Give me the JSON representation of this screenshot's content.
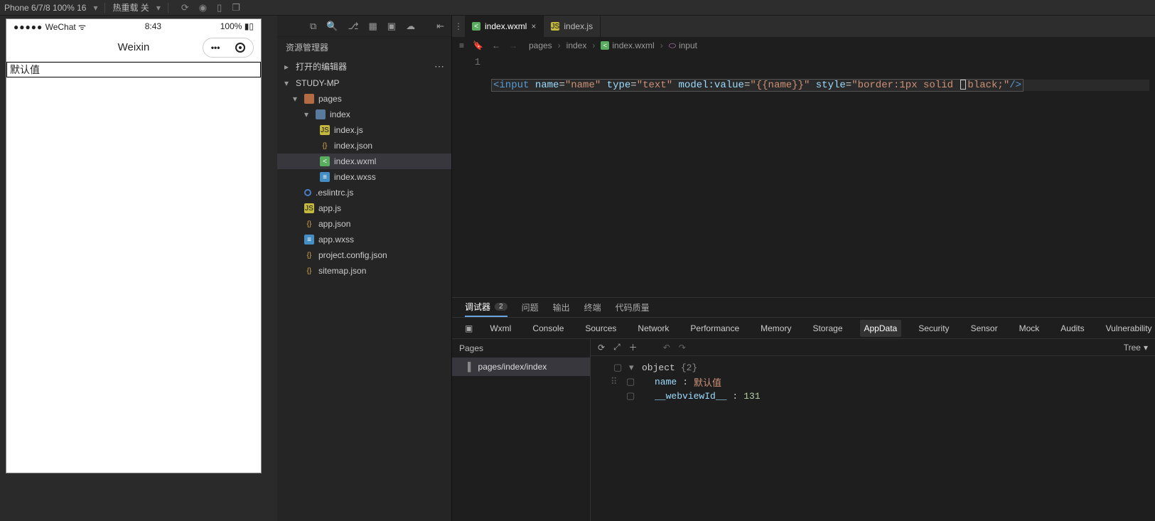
{
  "topbar": {
    "device": "Phone 6/7/8 100% 16",
    "hotreload": "热重载 关"
  },
  "simulator": {
    "carrier": "WeChat",
    "time": "8:43",
    "battery": "100%",
    "title": "Weixin",
    "inputValue": "默认值"
  },
  "explorer": {
    "title": "资源管理器",
    "openEditors": "打开的编辑器",
    "project": "STUDY-MP",
    "tree": {
      "f0": "pages",
      "f1": "index",
      "f2": "index.js",
      "f3": "index.json",
      "f4": "index.wxml",
      "f5": "index.wxss",
      "f6": ".eslintrc.js",
      "f7": "app.js",
      "f8": "app.json",
      "f9": "app.wxss",
      "f10": "project.config.json",
      "f11": "sitemap.json"
    }
  },
  "tabs": {
    "t0": "index.wxml",
    "t1": "index.js"
  },
  "breadcrumb": {
    "b0": "pages",
    "b1": "index",
    "b2": "index.wxml",
    "b3": "input"
  },
  "editor": {
    "lineNum": "1",
    "code": {
      "lt": "<",
      "tag_open": "input",
      "attr_name": "name",
      "val_name": "\"name\"",
      "attr_type": "type",
      "val_type": "\"text\"",
      "attr_model": "model:value",
      "val_model": "\"{{name}}\"",
      "attr_style": "style",
      "val_style_a": "\"border:1px solid ",
      "val_style_b": "black;\"",
      "close": "/>"
    }
  },
  "bottomTabs1": {
    "t0": "调试器",
    "badge": "2",
    "t1": "问题",
    "t2": "输出",
    "t3": "终端",
    "t4": "代码质量"
  },
  "bottomTabs2": {
    "t0": "Wxml",
    "t1": "Console",
    "t2": "Sources",
    "t3": "Network",
    "t4": "Performance",
    "t5": "Memory",
    "t6": "Storage",
    "t7": "AppData",
    "t8": "Security",
    "t9": "Sensor",
    "t10": "Mock",
    "t11": "Audits",
    "t12": "Vulnerability"
  },
  "pagesPane": {
    "hdr": "Pages",
    "item": "pages/index/index"
  },
  "dataTree": {
    "mode": "Tree",
    "root": "object",
    "rootMeta": "{2}",
    "k0": "name",
    "v0": "默认值",
    "k1": "__webviewId__",
    "v1": "131"
  }
}
